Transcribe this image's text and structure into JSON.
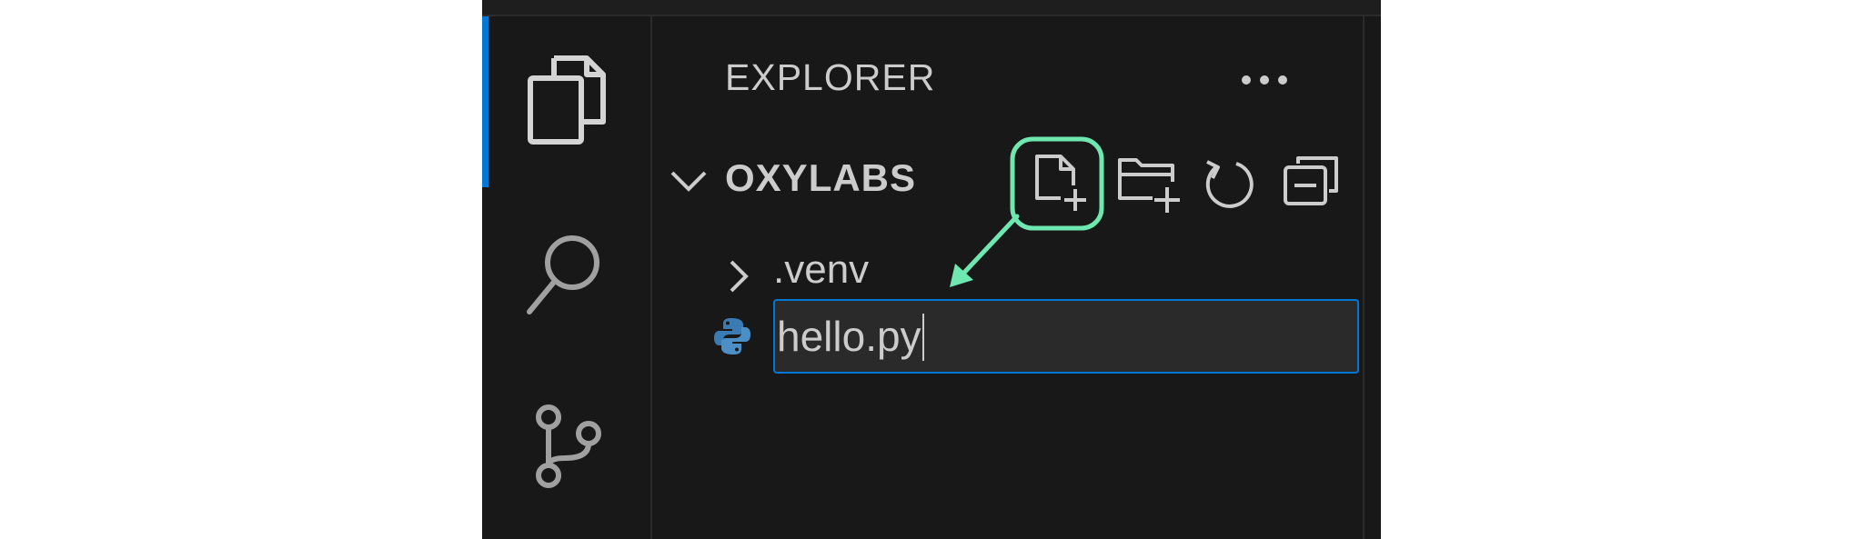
{
  "app": {
    "activity_bar": {
      "items": [
        {
          "name": "explorer",
          "icon": "files-icon",
          "active": true
        },
        {
          "name": "search",
          "icon": "search-icon",
          "active": false
        },
        {
          "name": "source-control",
          "icon": "source-control-icon",
          "active": false
        }
      ]
    },
    "sidebar": {
      "title": "EXPLORER",
      "more_actions_icon": "ellipsis-icon",
      "folder": {
        "name": "OXYLABS",
        "expanded": true,
        "toolbar": [
          {
            "name": "new-file",
            "icon": "new-file-icon",
            "highlighted": true
          },
          {
            "name": "new-folder",
            "icon": "new-folder-icon",
            "highlighted": false
          },
          {
            "name": "refresh",
            "icon": "refresh-icon",
            "highlighted": false
          },
          {
            "name": "collapse-all",
            "icon": "collapse-all-icon",
            "highlighted": false
          }
        ],
        "items": [
          {
            "type": "folder",
            "name": ".venv",
            "expanded": false,
            "icon": "chevron-right-icon"
          },
          {
            "type": "file-input",
            "value": "hello.py",
            "icon": "python-icon"
          }
        ]
      }
    }
  },
  "colors": {
    "background": "#181818",
    "text": "#cccccc",
    "accent": "#0078d4",
    "annotation": "#6ee7b0",
    "python_blue": "#3b7bb4",
    "python_light": "#4b8fc6"
  }
}
